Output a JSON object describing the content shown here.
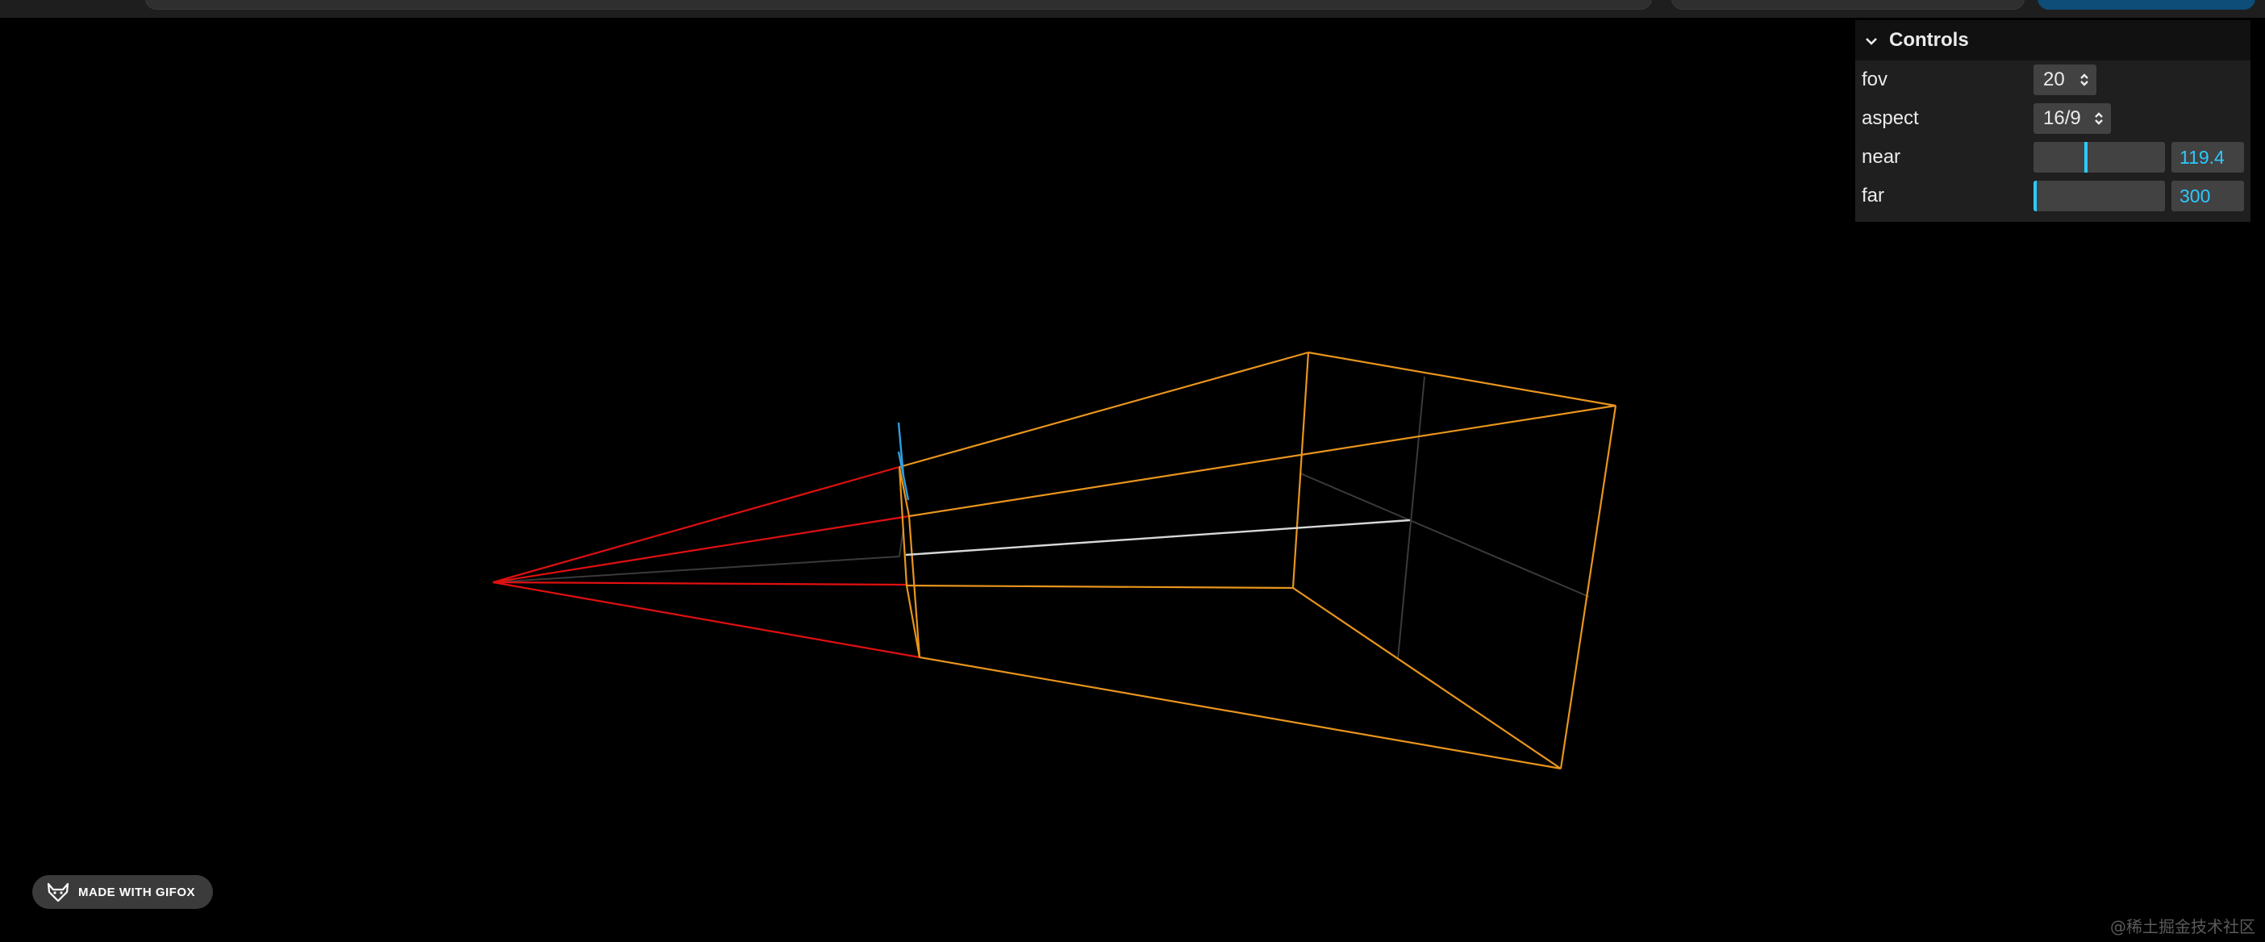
{
  "controls": {
    "title": "Controls",
    "fov": {
      "label": "fov",
      "value": "20"
    },
    "aspect": {
      "label": "aspect",
      "value": "16/9"
    },
    "near": {
      "label": "near",
      "value": "119.4",
      "fraction": 0.398
    },
    "far": {
      "label": "far",
      "value": "300",
      "fraction": 0.0
    }
  },
  "badge": {
    "text": "MADE WITH GIFOX"
  },
  "watermark": "@稀土掘金技术社区",
  "colors": {
    "frustum_near": "#e01010",
    "frustum_far": "#e8951c",
    "center_line": "#d8d8d8",
    "up_marker": "#2c9fe0",
    "accent": "#2cc9ff",
    "panel_bg": "#1f1f1f",
    "panel_title_bg": "#111111",
    "widget_bg": "#424242"
  }
}
